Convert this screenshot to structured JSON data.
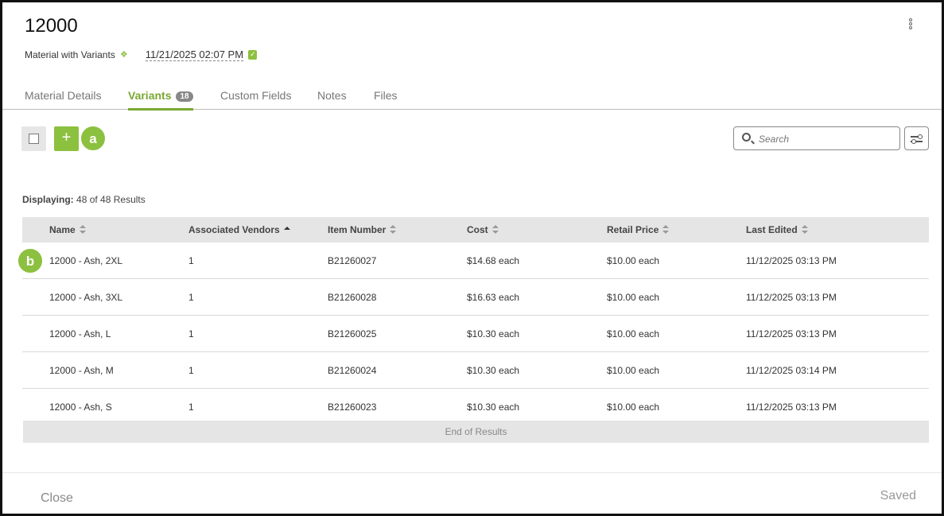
{
  "header": {
    "title": "12000",
    "type_label": "Material with Variants",
    "date": "11/21/2025 02:07 PM"
  },
  "tabs": [
    {
      "label": "Material Details"
    },
    {
      "label": "Variants",
      "badge": "18"
    },
    {
      "label": "Custom Fields"
    },
    {
      "label": "Notes"
    },
    {
      "label": "Files"
    }
  ],
  "active_tab": "Variants",
  "toolbar": {
    "add_label": "+",
    "search_placeholder": "Search"
  },
  "markers": {
    "a": "a",
    "b": "b"
  },
  "results": {
    "label": "Displaying:",
    "text": "48 of 48 Results"
  },
  "table": {
    "columns": [
      "Name",
      "Associated Vendors",
      "Item Number",
      "Cost",
      "Retail Price",
      "Last Edited"
    ],
    "sorted_column": "Associated Vendors",
    "sort_direction": "ascending",
    "rows": [
      {
        "name": "12000 - Ash, 2XL",
        "vendors": "1",
        "item": "B21260027",
        "cost": "$14.68 each",
        "retail": "$10.00 each",
        "edited": "11/12/2025 03:13 PM"
      },
      {
        "name": "12000 - Ash, 3XL",
        "vendors": "1",
        "item": "B21260028",
        "cost": "$16.63 each",
        "retail": "$10.00 each",
        "edited": "11/12/2025 03:13 PM"
      },
      {
        "name": "12000 - Ash, L",
        "vendors": "1",
        "item": "B21260025",
        "cost": "$10.30 each",
        "retail": "$10.00 each",
        "edited": "11/12/2025 03:13 PM"
      },
      {
        "name": "12000 - Ash, M",
        "vendors": "1",
        "item": "B21260024",
        "cost": "$10.30 each",
        "retail": "$10.00 each",
        "edited": "11/12/2025 03:14 PM"
      },
      {
        "name": "12000 - Ash, S",
        "vendors": "1",
        "item": "B21260023",
        "cost": "$10.30 each",
        "retail": "$10.00 each",
        "edited": "11/12/2025 03:13 PM"
      }
    ],
    "end_text": "End of Results"
  },
  "footer": {
    "close_label": "Close",
    "status": "Saved"
  },
  "colors": {
    "accent": "#8cc03f",
    "tab_active": "#7aa833",
    "header_bg": "#e5e5e5"
  },
  "icons": [
    "kebab-menu-icon",
    "diamond-variants-icon",
    "calendar-check-icon",
    "search-icon",
    "filter-sliders-icon",
    "sort-icon"
  ]
}
